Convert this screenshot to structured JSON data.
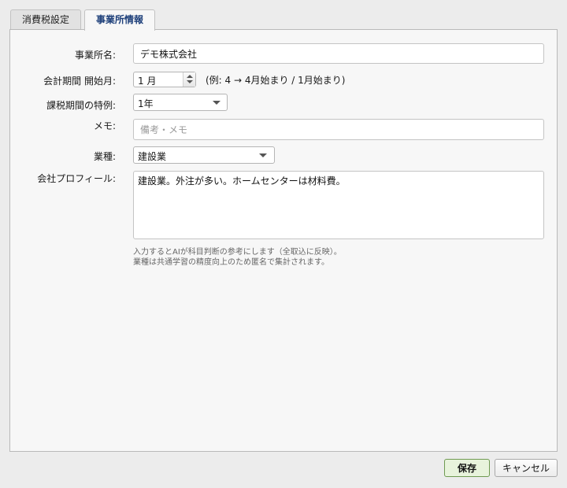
{
  "tabs": [
    {
      "label": "消費税設定",
      "active": false
    },
    {
      "label": "事業所情報",
      "active": true
    }
  ],
  "form": {
    "office_name": {
      "label": "事業所名:",
      "value": "デモ株式会社"
    },
    "fiscal_start": {
      "label": "会計期間 開始月:",
      "value": "1 月",
      "hint": "(例: 4 → 4月始まり / 1月始まり)"
    },
    "tax_period": {
      "label": "課税期間の特例:",
      "value": "1年"
    },
    "memo": {
      "label": "メモ:",
      "value": "",
      "placeholder": "備考・メモ"
    },
    "industry": {
      "label": "業種:",
      "value": "建設業"
    },
    "profile": {
      "label": "会社プロフィール:",
      "value": "建設業。外注が多い。ホームセンターは材料費。"
    },
    "note_lines": [
      "入力するとAIが科目判断の参考にします（全取込に反映）。",
      "業種は共通学習の精度向上のため匿名で集計されます。"
    ]
  },
  "buttons": {
    "save": "保存",
    "cancel": "キャンセル"
  },
  "colors": {
    "active_tab_text": "#1d3f7a",
    "save_bg": "#e8f3dc",
    "save_border": "#6f9a52"
  }
}
